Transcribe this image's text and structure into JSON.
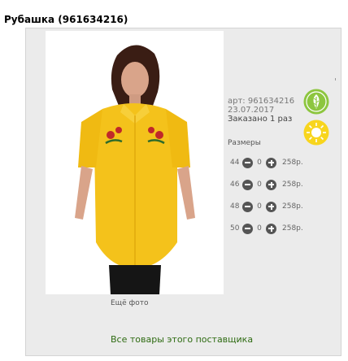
{
  "product": {
    "title": "Рубашка (961634216)",
    "article": "арт: 961634216",
    "date": "23.07.2017",
    "ordered": "Заказано 1 раз"
  },
  "icons": {
    "eco": "leaf-icon",
    "sun": "sun-icon"
  },
  "colors": {
    "panel_bg": "#ebebeb",
    "link_green": "#2e6b12",
    "shirt_yellow": "#f4c21b",
    "eco_green": "#8dc63f",
    "sun_yellow": "#f8d51d"
  },
  "sizes": {
    "label": "Размеры",
    "rows": [
      {
        "size": "44",
        "qty": "0",
        "price": "258р."
      },
      {
        "size": "46",
        "qty": "0",
        "price": "258р."
      },
      {
        "size": "48",
        "qty": "0",
        "price": "258р."
      },
      {
        "size": "50",
        "qty": "0",
        "price": "258р."
      }
    ]
  },
  "links": {
    "more_photo": "Ещё фото",
    "all_goods": "Все товары этого поставщика"
  }
}
